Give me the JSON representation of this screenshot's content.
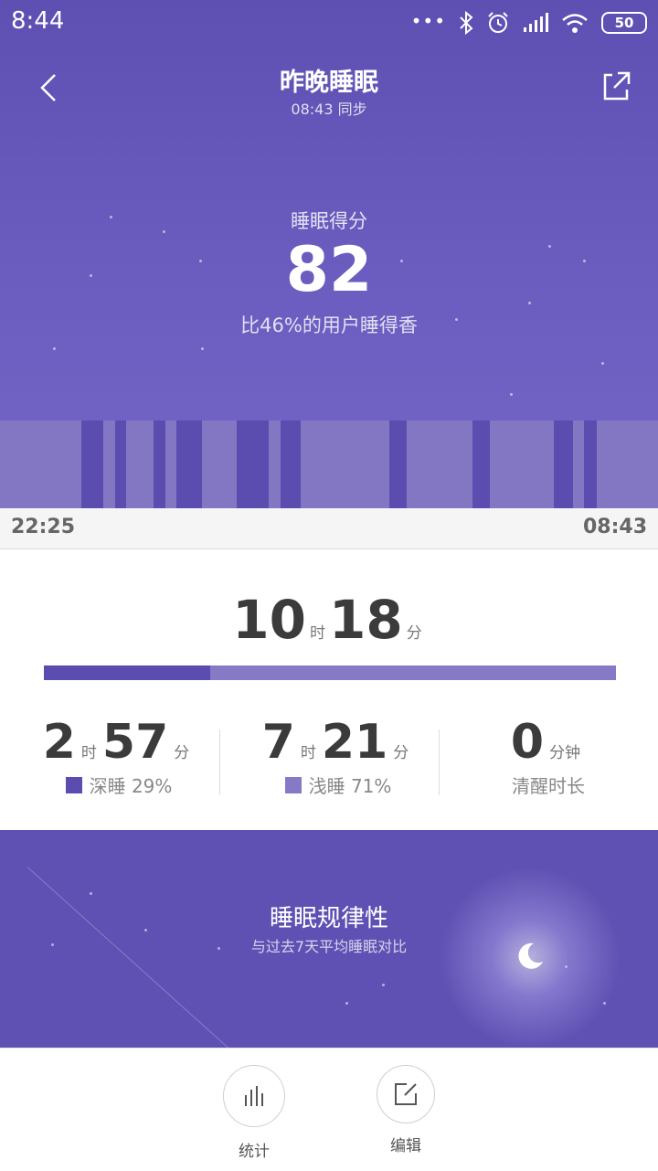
{
  "status_bar": {
    "time": "8:44",
    "dots": "•••",
    "battery": "50"
  },
  "header": {
    "title": "昨晚睡眠",
    "sync_text": "08:43 同步"
  },
  "score": {
    "label": "睡眠得分",
    "value": "82",
    "compare_text": "比46%的用户睡得香"
  },
  "timeline": {
    "start": "22:25",
    "end": "08:43",
    "deep_segments": [
      {
        "start": 0.124,
        "end": 0.157
      },
      {
        "start": 0.175,
        "end": 0.192
      },
      {
        "start": 0.233,
        "end": 0.252
      },
      {
        "start": 0.268,
        "end": 0.307
      },
      {
        "start": 0.36,
        "end": 0.409
      },
      {
        "start": 0.426,
        "end": 0.457
      },
      {
        "start": 0.592,
        "end": 0.618
      },
      {
        "start": 0.718,
        "end": 0.745
      },
      {
        "start": 0.842,
        "end": 0.871
      },
      {
        "start": 0.888,
        "end": 0.907
      }
    ]
  },
  "total": {
    "hours": "10",
    "hours_unit": "时",
    "minutes": "18",
    "minutes_unit": "分",
    "deep_fraction": 0.29
  },
  "stats": {
    "deep": {
      "hours": "2",
      "hours_unit": "时",
      "minutes": "57",
      "minutes_unit": "分",
      "label": "深睡 29%"
    },
    "light": {
      "hours": "7",
      "hours_unit": "时",
      "minutes": "21",
      "minutes_unit": "分",
      "label": "浅睡 71%"
    },
    "awake": {
      "minutes": "0",
      "minutes_unit": "分钟",
      "label": "清醒时长"
    }
  },
  "regularity": {
    "title": "睡眠规律性",
    "subtitle": "与过去7天平均睡眠对比"
  },
  "toolbar": {
    "stats_label": "统计",
    "edit_label": "编辑"
  },
  "colors": {
    "hero": "#5e4fb2",
    "deep": "#5b4daf",
    "light": "#8679c6"
  },
  "icons": [
    "back-icon",
    "share-icon",
    "bluetooth-icon",
    "alarm-icon",
    "signal-icon",
    "wifi-icon",
    "battery-icon",
    "bar-chart-icon",
    "edit-icon",
    "moon-icon"
  ]
}
